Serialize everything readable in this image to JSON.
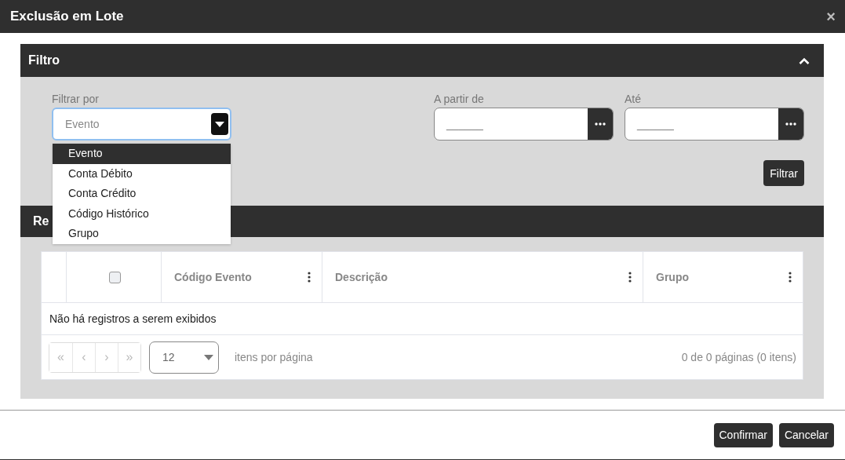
{
  "dialog": {
    "title": "Exclusão em Lote",
    "close": "×"
  },
  "filter_panel": {
    "title": "Filtro",
    "expanded": true,
    "filter_by": {
      "label": "Filtrar por",
      "value": "Evento",
      "open": true,
      "options": [
        {
          "label": "Evento",
          "selected": true
        },
        {
          "label": "Conta Débito",
          "selected": false
        },
        {
          "label": "Conta Crédito",
          "selected": false
        },
        {
          "label": "Código Histórico",
          "selected": false
        },
        {
          "label": "Grupo",
          "selected": false
        }
      ]
    },
    "date_from": {
      "label": "A partir de",
      "value": "______"
    },
    "date_to": {
      "label": "Até",
      "value": "______"
    },
    "filter_button": "Filtrar"
  },
  "records_panel": {
    "title": "Re",
    "table": {
      "select_all_checked": false,
      "columns": [
        {
          "label": "Código Evento"
        },
        {
          "label": "Descrição"
        },
        {
          "label": "Grupo"
        }
      ],
      "empty_message": "Não há registros a serem exibidos",
      "pager": {
        "buttons": [
          "«",
          "‹",
          "›",
          "»"
        ],
        "page_size": "12",
        "page_size_label": "itens por página",
        "summary": "0 de 0 páginas (0 itens)"
      }
    }
  },
  "footer_buttons": [
    "Confirmar",
    "Cancelar"
  ]
}
